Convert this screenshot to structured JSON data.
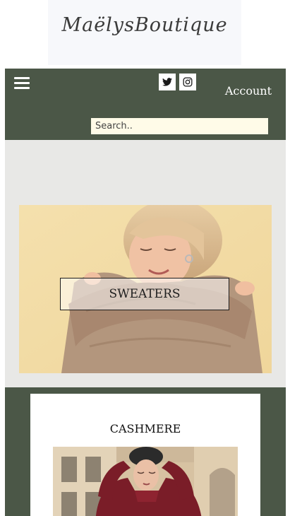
{
  "brand": {
    "logo_text": "MaëlysBoutique"
  },
  "nav": {
    "account_label": "Account",
    "social": [
      {
        "icon": "twitter-icon"
      },
      {
        "icon": "instagram-icon"
      }
    ],
    "search": {
      "placeholder": "Search..",
      "value": ""
    }
  },
  "hero": {
    "label": "SWEATERS"
  },
  "featured": {
    "title": "CASHMERE"
  },
  "colors": {
    "nav_bg": "#4b5747",
    "hero_bg": "#e8e8e6",
    "search_bg": "#fffbe8"
  }
}
